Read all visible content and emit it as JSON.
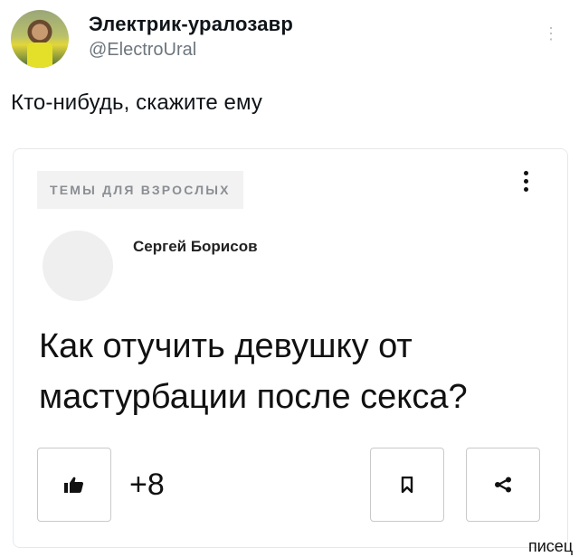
{
  "tweet": {
    "author_name": "Электрик-уралозавр",
    "handle": "@ElectroUral",
    "text": "Кто-нибудь, скажите ему",
    "menu_icon": "vertical-dots-icon"
  },
  "card": {
    "tag": "ТЕМЫ ДЛЯ ВЗРОСЛЫХ",
    "author": "Сергей Борисов",
    "question": "Как отучить девушку от мастурбации после секса?",
    "like_count": "+8",
    "icons": [
      "thumbs-up-icon",
      "bookmark-icon",
      "share-icon"
    ]
  },
  "watermark": "писец"
}
